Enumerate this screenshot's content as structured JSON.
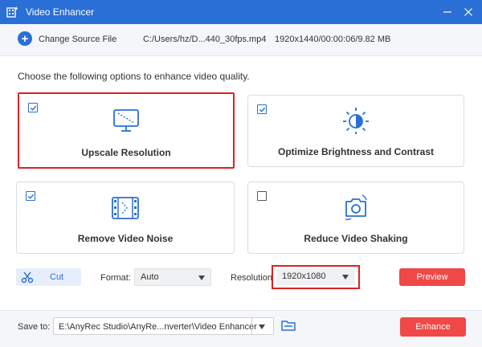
{
  "window": {
    "title": "Video Enhancer",
    "icons": {
      "app": "video-enhancer-app-icon",
      "minimize": "minimize-icon",
      "close": "close-icon"
    }
  },
  "source": {
    "add_icon": "plus-icon",
    "change_label": "Change Source File",
    "file_path": "C:/Users/hz/D...440_30fps.mp4",
    "file_meta": "1920x1440/00:00:06/9.82 MB"
  },
  "instructions": "Choose the following options to enhance video quality.",
  "options": [
    {
      "label": "Upscale Resolution",
      "checked": true,
      "icon": "upscale-monitor-icon"
    },
    {
      "label": "Optimize Brightness and Contrast",
      "checked": true,
      "icon": "brightness-sun-icon"
    },
    {
      "label": "Remove Video Noise",
      "checked": true,
      "icon": "film-strip-icon"
    },
    {
      "label": "Reduce Video Shaking",
      "checked": false,
      "icon": "camera-shake-icon"
    }
  ],
  "controls": {
    "cut_label": "Cut",
    "cut_icon": "scissors-icon",
    "format_label": "Format:",
    "format_value": "Auto",
    "resolution_label": "Resolution:",
    "resolution_value": "1920x1080",
    "preview_label": "Preview"
  },
  "footer": {
    "save_label": "Save to:",
    "save_path": "E:\\AnyRec Studio\\AnyRe...nverter\\Video Enhancer",
    "folder_icon": "folder-icon",
    "enhance_label": "Enhance"
  },
  "colors": {
    "titlebar": "#2a6fd6",
    "accent": "#2a6fd6",
    "action": "#f04747",
    "highlight": "#e02020"
  }
}
